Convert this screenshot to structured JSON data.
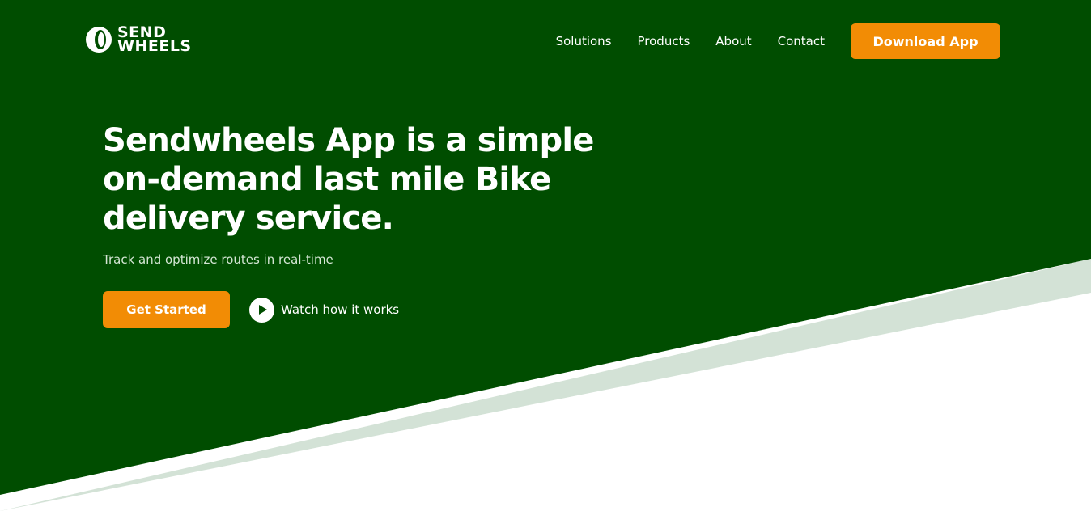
{
  "brand": {
    "name_line1": "SEND",
    "name_line2": "WHEELS"
  },
  "nav": {
    "items": [
      {
        "label": "Solutions"
      },
      {
        "label": "Products"
      },
      {
        "label": "About"
      },
      {
        "label": "Contact"
      }
    ],
    "download_label": "Download App"
  },
  "hero": {
    "headline": "Sendwheels App is a simple on-demand last mile Bike delivery service.",
    "subhead": "Track and optimize routes in real-time",
    "primary_cta": "Get Started",
    "secondary_cta": "Watch how it works",
    "secondary_icon": "play-icon"
  },
  "colors": {
    "hero_green": "#004d00",
    "stripe_light_green": "#d3e2d6",
    "accent_orange": "#f28c05",
    "text_white": "#ffffff"
  }
}
